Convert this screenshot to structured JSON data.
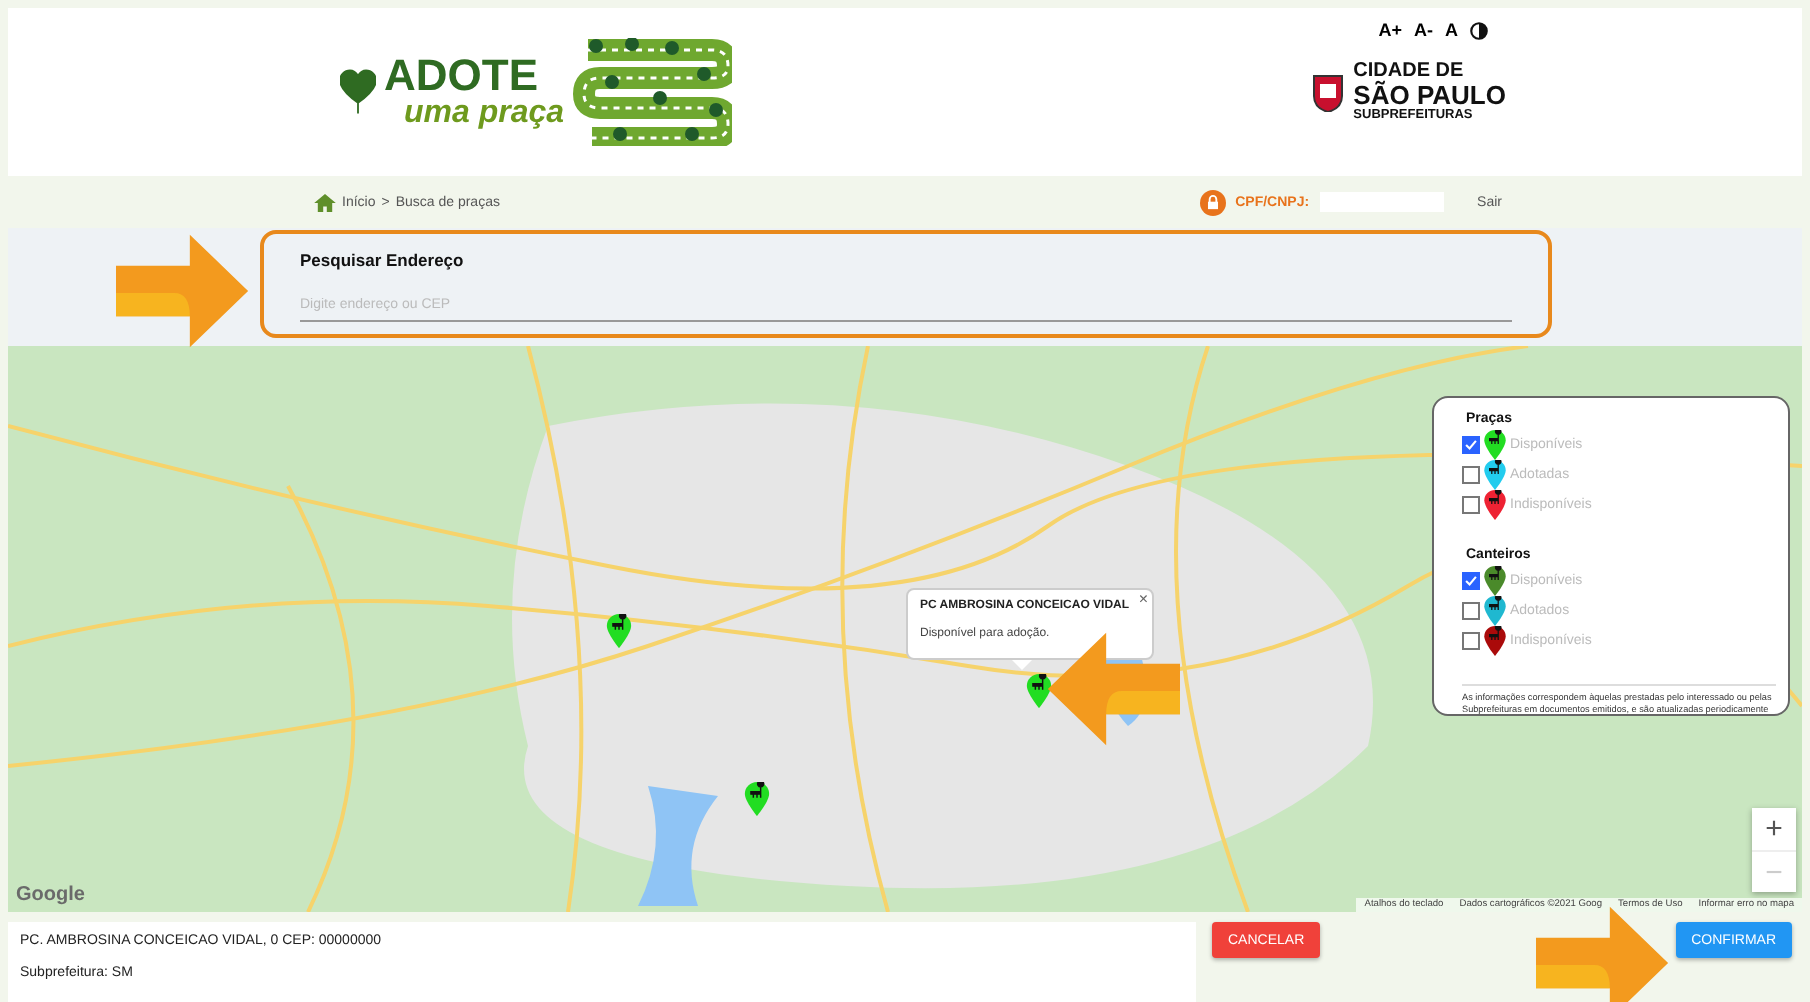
{
  "accessibility": {
    "buttons": [
      "A+",
      "A-",
      "A"
    ]
  },
  "logo": {
    "title": "ADOTE",
    "subtitle": "uma praça"
  },
  "city_logo": {
    "lines": [
      "CIDADE DE",
      "SÃO PAULO",
      "SUBPREFEITURAS"
    ]
  },
  "breadcrumb": {
    "items": [
      "Início",
      "Busca de praças"
    ],
    "separator": ">"
  },
  "user": {
    "label": "CPF/CNPJ:",
    "logout": "Sair"
  },
  "search": {
    "title": "Pesquisar Endereço",
    "placeholder": "Digite endereço ou CEP"
  },
  "map": {
    "popup": {
      "title": "PC AMBROSINA CONCEICAO VIDAL",
      "text": "Disponível para adoção.",
      "close": "×"
    },
    "legend": {
      "groups": [
        {
          "title": "Praças",
          "items": [
            {
              "label": "Disponíveis",
              "checked": true,
              "color": "#22dd22"
            },
            {
              "label": "Adotadas",
              "checked": false,
              "color": "#22ccee"
            },
            {
              "label": "Indisponíveis",
              "checked": false,
              "color": "#ee2233"
            }
          ]
        },
        {
          "title": "Canteiros",
          "items": [
            {
              "label": "Disponíveis",
              "checked": true,
              "color": "#4a8a2a"
            },
            {
              "label": "Adotados",
              "checked": false,
              "color": "#1fb8d0"
            },
            {
              "label": "Indisponíveis",
              "checked": false,
              "color": "#aa0a0a"
            }
          ]
        }
      ],
      "note": "As informações correspondem àquelas prestadas pelo interessado ou pelas Subprefeituras em documentos emitidos, e são atualizadas periodicamente"
    },
    "zoom": {
      "in": "+",
      "out": "−"
    },
    "google": "Google",
    "attribution": [
      "Atalhos do teclado",
      "Dados cartográficos ©2021 Goog",
      "Termos de Uso",
      "Informar erro no mapa"
    ]
  },
  "address": {
    "lines": [
      "PC. AMBROSINA CONCEICAO VIDAL, 0 CEP: 00000000",
      "Subprefeitura: SM"
    ]
  },
  "buttons": [
    {
      "label": "CANCELAR",
      "kind": "cancel"
    },
    {
      "label": "CONFIRMAR",
      "kind": "confirm"
    }
  ]
}
